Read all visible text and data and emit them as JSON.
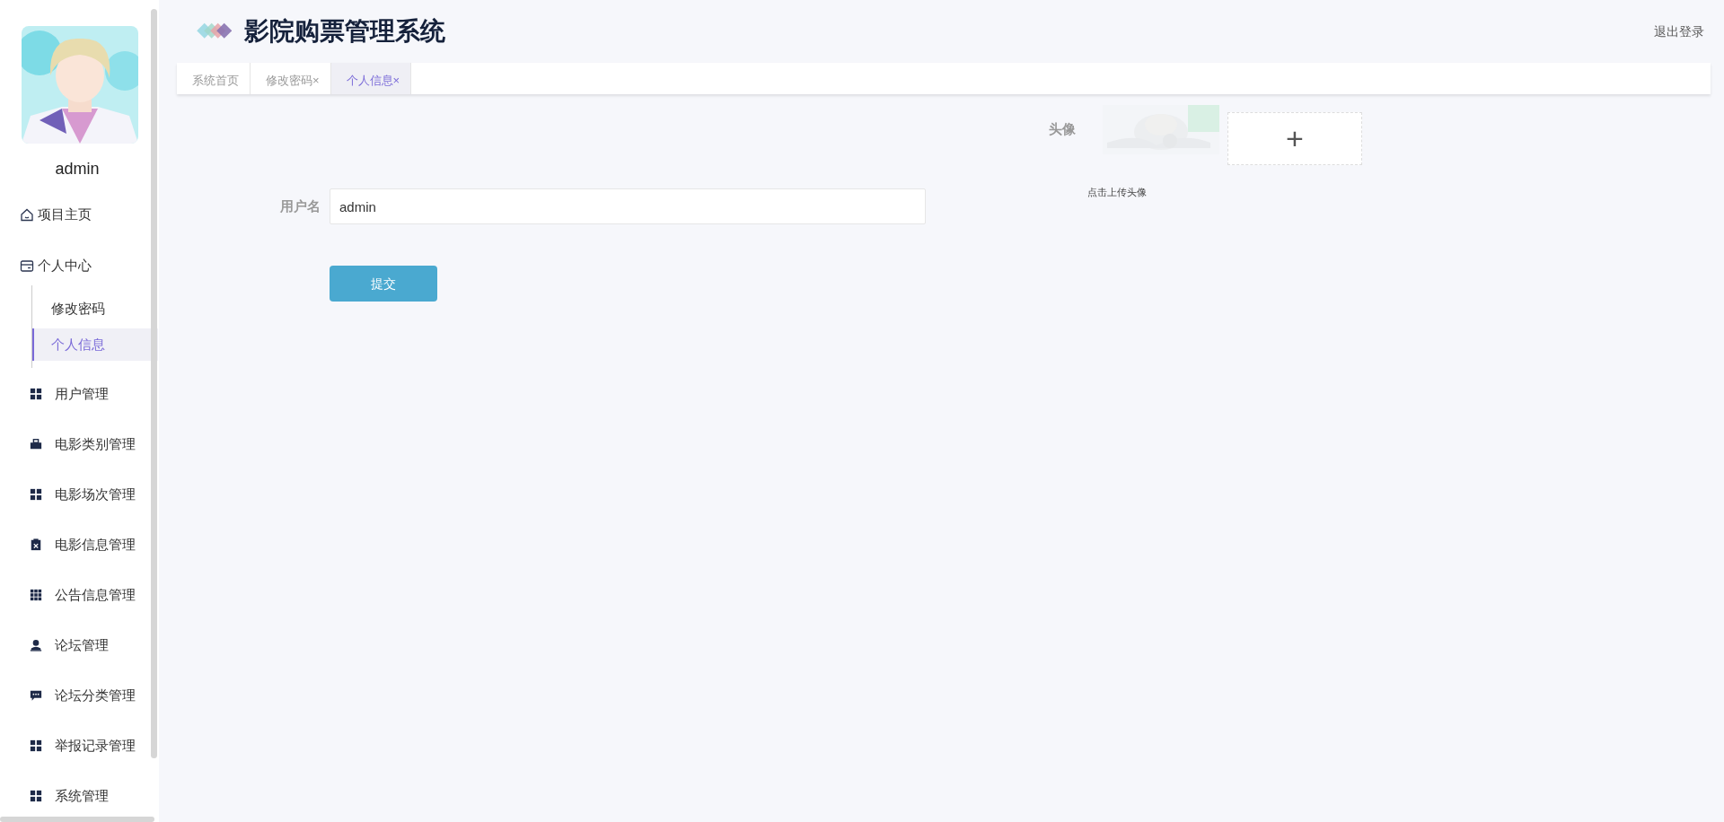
{
  "sidebar": {
    "username": "admin",
    "items": [
      {
        "label": "项目主页",
        "kind": "link",
        "selected": false
      },
      {
        "label": "个人中心",
        "kind": "group",
        "selected": false,
        "children": [
          {
            "label": "修改密码",
            "selected": false
          },
          {
            "label": "个人信息",
            "selected": true
          }
        ]
      },
      {
        "label": "用户管理",
        "kind": "module",
        "selected": false
      },
      {
        "label": "电影类别管理",
        "kind": "module",
        "selected": false
      },
      {
        "label": "电影场次管理",
        "kind": "module",
        "selected": false
      },
      {
        "label": "电影信息管理",
        "kind": "module",
        "selected": false
      },
      {
        "label": "公告信息管理",
        "kind": "module",
        "selected": false
      },
      {
        "label": "论坛管理",
        "kind": "module",
        "selected": false
      },
      {
        "label": "论坛分类管理",
        "kind": "module",
        "selected": false
      },
      {
        "label": "举报记录管理",
        "kind": "module",
        "selected": false
      },
      {
        "label": "系统管理",
        "kind": "module",
        "selected": false
      }
    ]
  },
  "header": {
    "title": "影院购票管理系统",
    "logout": "退出登录"
  },
  "tabs": [
    {
      "label": "系统首页",
      "selected": false
    },
    {
      "label": "修改密码",
      "close": "×",
      "selected": false
    },
    {
      "label": "个人信息",
      "close": "×",
      "selected": true
    }
  ],
  "form": {
    "avatar": {
      "label": "头像",
      "upload": "+",
      "hint": "点击上传头像"
    },
    "username": {
      "label": "用户名",
      "value": "admin"
    },
    "submit": "提交"
  }
}
